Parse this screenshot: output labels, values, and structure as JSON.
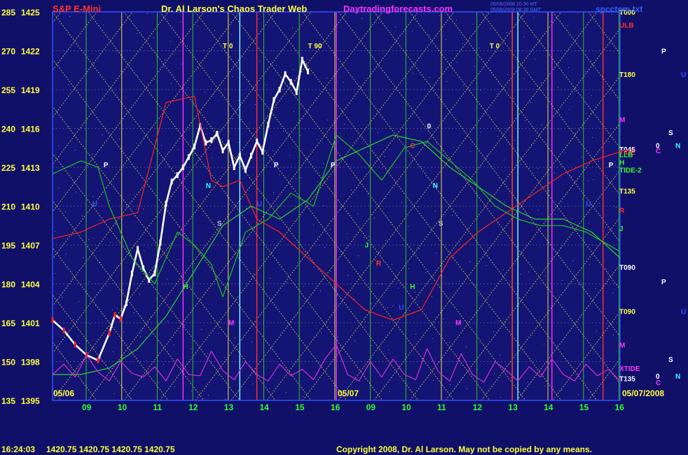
{
  "header": {
    "instrument": "S&P E-Mini",
    "title": "Dr. Al Larson's Chaos Trader Web",
    "site": "Daytradingforecasts.com",
    "file": "spcctom.txt",
    "stamp_line1": "05/06/2008 20:30 MT",
    "stamp_line2": "05/06/2008 08:30 GMT"
  },
  "footer": {
    "quote_time": "16:24:03",
    "quote_values": "1420.75  1420.75  1420.75  1420.75",
    "copyright": "Copyright 2008, Dr. Al Larson. May not be copied by any means."
  },
  "colors": {
    "background": "#101068",
    "plot_background": "#141474",
    "accent_red": "#ff3030",
    "accent_magenta": "#ff33ff",
    "grid_yellow": "#e0e050",
    "grid_green": "#30c030",
    "grid_cyan": "#80ffff",
    "price_white": "#ffffff",
    "title_yellow": "#ffff40"
  },
  "chart_data": {
    "type": "line",
    "title": "Dr. Al Larson's Chaos Trader Web",
    "ylim": [
      1395,
      1425
    ],
    "y_ticks": [
      1425,
      1422,
      1419,
      1416,
      1413,
      1410,
      1407,
      1404,
      1401,
      1398,
      1395
    ],
    "y_degree_ticks": [
      285,
      270,
      255,
      240,
      225,
      210,
      195,
      180,
      165,
      150,
      135
    ],
    "x_tick_labels": [
      "09",
      "10",
      "11",
      "12",
      "13",
      "14",
      "15",
      "16",
      "09",
      "10",
      "11",
      "12",
      "13",
      "14",
      "15",
      "16"
    ],
    "date_labels": [
      "05/06",
      "05/07",
      "05/07/2008"
    ],
    "right_labels": [
      {
        "text": "T000",
        "value": 1425,
        "color": "#ffff40"
      },
      {
        "text": "ULB",
        "value": 1424,
        "color": "#ff3030"
      },
      {
        "text": "T180",
        "value": 1420.2,
        "color": "#ffff40"
      },
      {
        "text": "M",
        "value": 1416.7,
        "color": "#ff33ff"
      },
      {
        "text": "T045",
        "value": 1414.4,
        "color": "#ffffff"
      },
      {
        "text": "TIDE",
        "value": 1414.2,
        "color": "#ff3030"
      },
      {
        "text": "LLB",
        "value": 1414.0,
        "color": "#30ff30"
      },
      {
        "text": "H",
        "value": 1413.4,
        "color": "#30ff30"
      },
      {
        "text": "TIDE-2",
        "value": 1412.8,
        "color": "#30ff30"
      },
      {
        "text": "T135",
        "value": 1411.2,
        "color": "#ffff40"
      },
      {
        "text": "R",
        "value": 1409.7,
        "color": "#ff3030"
      },
      {
        "text": "J",
        "value": 1408.3,
        "color": "#30ff30"
      },
      {
        "text": "T090",
        "value": 1405.3,
        "color": "#ffffff"
      },
      {
        "text": "T090",
        "value": 1401.9,
        "color": "#ffff40"
      },
      {
        "text": "M",
        "value": 1399.3,
        "color": "#ff33ff"
      },
      {
        "text": "XTIDE",
        "value": 1397.5,
        "color": "#ff33ff"
      },
      {
        "text": "T135",
        "value": 1396.7,
        "color": "#ffffff"
      }
    ],
    "far_right_letters": [
      {
        "text": "P",
        "value": 1422,
        "color": "#ffffff"
      },
      {
        "text": "U",
        "value": 1420.2,
        "color": "#3050ff"
      },
      {
        "text": "S",
        "value": 1415.7,
        "color": "#ffffff"
      },
      {
        "text": "N",
        "value": 1414.7,
        "color": "#40ffff"
      },
      {
        "text": "0",
        "value": 1414.7,
        "color": "#ffffff"
      },
      {
        "text": "C",
        "value": 1414.3,
        "color": "#ff33ff"
      },
      {
        "text": "P",
        "value": 1404.2,
        "color": "#ffffff"
      },
      {
        "text": "U",
        "value": 1401.9,
        "color": "#3050ff"
      },
      {
        "text": "S",
        "value": 1398.2,
        "color": "#ffffff"
      },
      {
        "text": "N",
        "value": 1396.9,
        "color": "#40ffff"
      },
      {
        "text": "0",
        "value": 1396.9,
        "color": "#ffffff"
      },
      {
        "text": "C",
        "value": 1396.4,
        "color": "#ff33ff"
      }
    ],
    "annotations": [
      {
        "text": "T 0",
        "x": 0.3,
        "value": 1422.2,
        "color": "#ffff40"
      },
      {
        "text": "T 90",
        "x": 0.45,
        "value": 1422.2,
        "color": "#ffff40"
      },
      {
        "text": "T 0",
        "x": 0.77,
        "value": 1422.2,
        "color": "#ffff40"
      },
      {
        "text": "P",
        "x": 0.09,
        "value": 1413.0,
        "color": "#ffffff"
      },
      {
        "text": "P",
        "x": 0.39,
        "value": 1413.0,
        "color": "#ffffff"
      },
      {
        "text": "P",
        "x": 0.49,
        "value": 1413.0,
        "color": "#ffffff"
      },
      {
        "text": "P",
        "x": 0.98,
        "value": 1413.0,
        "color": "#ffffff"
      },
      {
        "text": "N",
        "x": 0.27,
        "value": 1411.4,
        "color": "#40ffff"
      },
      {
        "text": "N",
        "x": 0.67,
        "value": 1411.4,
        "color": "#40ffff"
      },
      {
        "text": "S",
        "x": 0.29,
        "value": 1408.5,
        "color": "#c0c0c0"
      },
      {
        "text": "S",
        "x": 0.68,
        "value": 1408.5,
        "color": "#c0c0c0"
      },
      {
        "text": "0",
        "x": 0.66,
        "value": 1416.0,
        "color": "#ffffff"
      },
      {
        "text": "M",
        "x": 0.31,
        "value": 1400.8,
        "color": "#ff33ff"
      },
      {
        "text": "M",
        "x": 0.71,
        "value": 1400.8,
        "color": "#ff33ff"
      },
      {
        "text": "J",
        "x": 0.55,
        "value": 1406.8,
        "color": "#30ff30"
      },
      {
        "text": "R",
        "x": 0.57,
        "value": 1405.4,
        "color": "#ff3030"
      },
      {
        "text": "H",
        "x": 0.63,
        "value": 1403.6,
        "color": "#30ff30"
      },
      {
        "text": "H",
        "x": 0.23,
        "value": 1403.6,
        "color": "#30ff30"
      },
      {
        "text": "U",
        "x": 0.61,
        "value": 1402.0,
        "color": "#3050ff"
      },
      {
        "text": "U",
        "x": 0.07,
        "value": 1410.0,
        "color": "#3050ff"
      },
      {
        "text": "U",
        "x": 0.36,
        "value": 1410.0,
        "color": "#3050ff"
      },
      {
        "text": "U",
        "x": 0.94,
        "value": 1410.0,
        "color": "#3050ff"
      },
      {
        "text": "C",
        "x": 0.63,
        "value": 1414.5,
        "color": "#ff3030"
      }
    ],
    "series": [
      {
        "name": "price",
        "color": "#ffffff",
        "x": [
          0.0,
          0.02,
          0.04,
          0.06,
          0.08,
          0.1,
          0.11,
          0.12,
          0.13,
          0.14,
          0.15,
          0.16,
          0.17,
          0.18,
          0.19,
          0.2,
          0.21,
          0.22,
          0.23,
          0.24,
          0.25,
          0.26,
          0.27,
          0.28,
          0.29,
          0.3,
          0.31,
          0.32,
          0.33,
          0.34,
          0.35,
          0.36,
          0.37,
          0.38,
          0.39,
          0.4,
          0.41,
          0.42,
          0.43,
          0.44,
          0.45
        ],
        "y": [
          1401.2,
          1400.4,
          1399.3,
          1398.5,
          1398.1,
          1400.2,
          1401.6,
          1401.3,
          1402.5,
          1404.8,
          1406.7,
          1405.2,
          1404.3,
          1404.8,
          1407.2,
          1410.2,
          1411.9,
          1412.4,
          1413.0,
          1413.8,
          1414.6,
          1416.2,
          1414.9,
          1415.1,
          1415.6,
          1414.3,
          1414.9,
          1413.0,
          1413.9,
          1412.8,
          1413.9,
          1415.0,
          1414.2,
          1416.3,
          1418.2,
          1419.0,
          1420.2,
          1419.6,
          1418.8,
          1421.3,
          1420.4
        ]
      },
      {
        "name": "tide",
        "color": "#ff2020",
        "x": [
          0.0,
          0.05,
          0.1,
          0.15,
          0.2,
          0.25,
          0.28,
          0.3,
          0.33,
          0.36,
          0.4,
          0.45,
          0.5,
          0.55,
          0.6,
          0.65,
          0.7,
          0.75,
          0.8,
          0.85,
          0.9,
          0.95,
          1.0
        ],
        "y": [
          1407.5,
          1408.0,
          1409.0,
          1409.5,
          1418.0,
          1418.5,
          1412.0,
          1411.5,
          1412.0,
          1409.0,
          1408.0,
          1406.0,
          1404.0,
          1402.0,
          1401.2,
          1402.0,
          1406.0,
          1408.0,
          1409.5,
          1411.0,
          1412.5,
          1413.5,
          1414.2
        ]
      },
      {
        "name": "llb",
        "color": "#20c020",
        "x": [
          0.0,
          0.05,
          0.08,
          0.1,
          0.14,
          0.18,
          0.22,
          0.25,
          0.28,
          0.3,
          0.34,
          0.38,
          0.42,
          0.46,
          0.5,
          0.54,
          0.58,
          0.62,
          0.66,
          0.7,
          0.74,
          0.78,
          0.82,
          0.86,
          0.9,
          0.94,
          1.0
        ],
        "y": [
          1412.5,
          1413.5,
          1413.0,
          1410.0,
          1406.0,
          1404.0,
          1408.0,
          1407.0,
          1405.5,
          1403.0,
          1408.0,
          1409.0,
          1411.0,
          1410.0,
          1415.5,
          1414.0,
          1412.0,
          1414.5,
          1415.0,
          1413.5,
          1412.0,
          1410.0,
          1409.0,
          1408.5,
          1408.5,
          1408.0,
          1406.5
        ]
      },
      {
        "name": "tide-2",
        "color": "#30d030",
        "x": [
          0.0,
          0.05,
          0.1,
          0.15,
          0.2,
          0.25,
          0.3,
          0.35,
          0.4,
          0.45,
          0.5,
          0.55,
          0.6,
          0.65,
          0.7,
          0.75,
          0.8,
          0.85,
          0.9,
          0.95,
          1.0
        ],
        "y": [
          1397.0,
          1397.0,
          1397.5,
          1399.0,
          1401.5,
          1405.0,
          1408.5,
          1410.0,
          1409.0,
          1410.5,
          1413.5,
          1414.5,
          1415.5,
          1415.0,
          1413.0,
          1411.5,
          1410.0,
          1409.0,
          1409.0,
          1408.0,
          1406.0
        ]
      },
      {
        "name": "xtide",
        "color": "#d030d0",
        "x": [
          0.0,
          0.02,
          0.04,
          0.06,
          0.08,
          0.1,
          0.12,
          0.14,
          0.16,
          0.18,
          0.2,
          0.22,
          0.24,
          0.26,
          0.28,
          0.3,
          0.32,
          0.34,
          0.36,
          0.38,
          0.4,
          0.42,
          0.44,
          0.46,
          0.48,
          0.5,
          0.52,
          0.54,
          0.56,
          0.58,
          0.6,
          0.62,
          0.64,
          0.66,
          0.68,
          0.7,
          0.72,
          0.74,
          0.76,
          0.78,
          0.8,
          0.82,
          0.84,
          0.86,
          0.88,
          0.9,
          0.92,
          0.94,
          0.96,
          0.98,
          1.0
        ],
        "y": [
          1397.0,
          1397.8,
          1396.8,
          1398.5,
          1397.2,
          1396.5,
          1398.0,
          1397.1,
          1396.8,
          1397.6,
          1396.5,
          1398.2,
          1397.0,
          1396.9,
          1398.8,
          1397.3,
          1396.6,
          1398.0,
          1397.0,
          1396.5,
          1397.8,
          1396.9,
          1397.4,
          1396.6,
          1398.2,
          1399.3,
          1397.0,
          1396.5,
          1398.0,
          1396.8,
          1398.2,
          1397.0,
          1396.6,
          1399.0,
          1397.2,
          1396.5,
          1398.6,
          1397.0,
          1396.4,
          1398.0,
          1397.3,
          1396.5,
          1397.6,
          1396.8,
          1398.2,
          1397.0,
          1396.5,
          1397.8,
          1396.9,
          1397.4,
          1396.5
        ]
      }
    ]
  }
}
